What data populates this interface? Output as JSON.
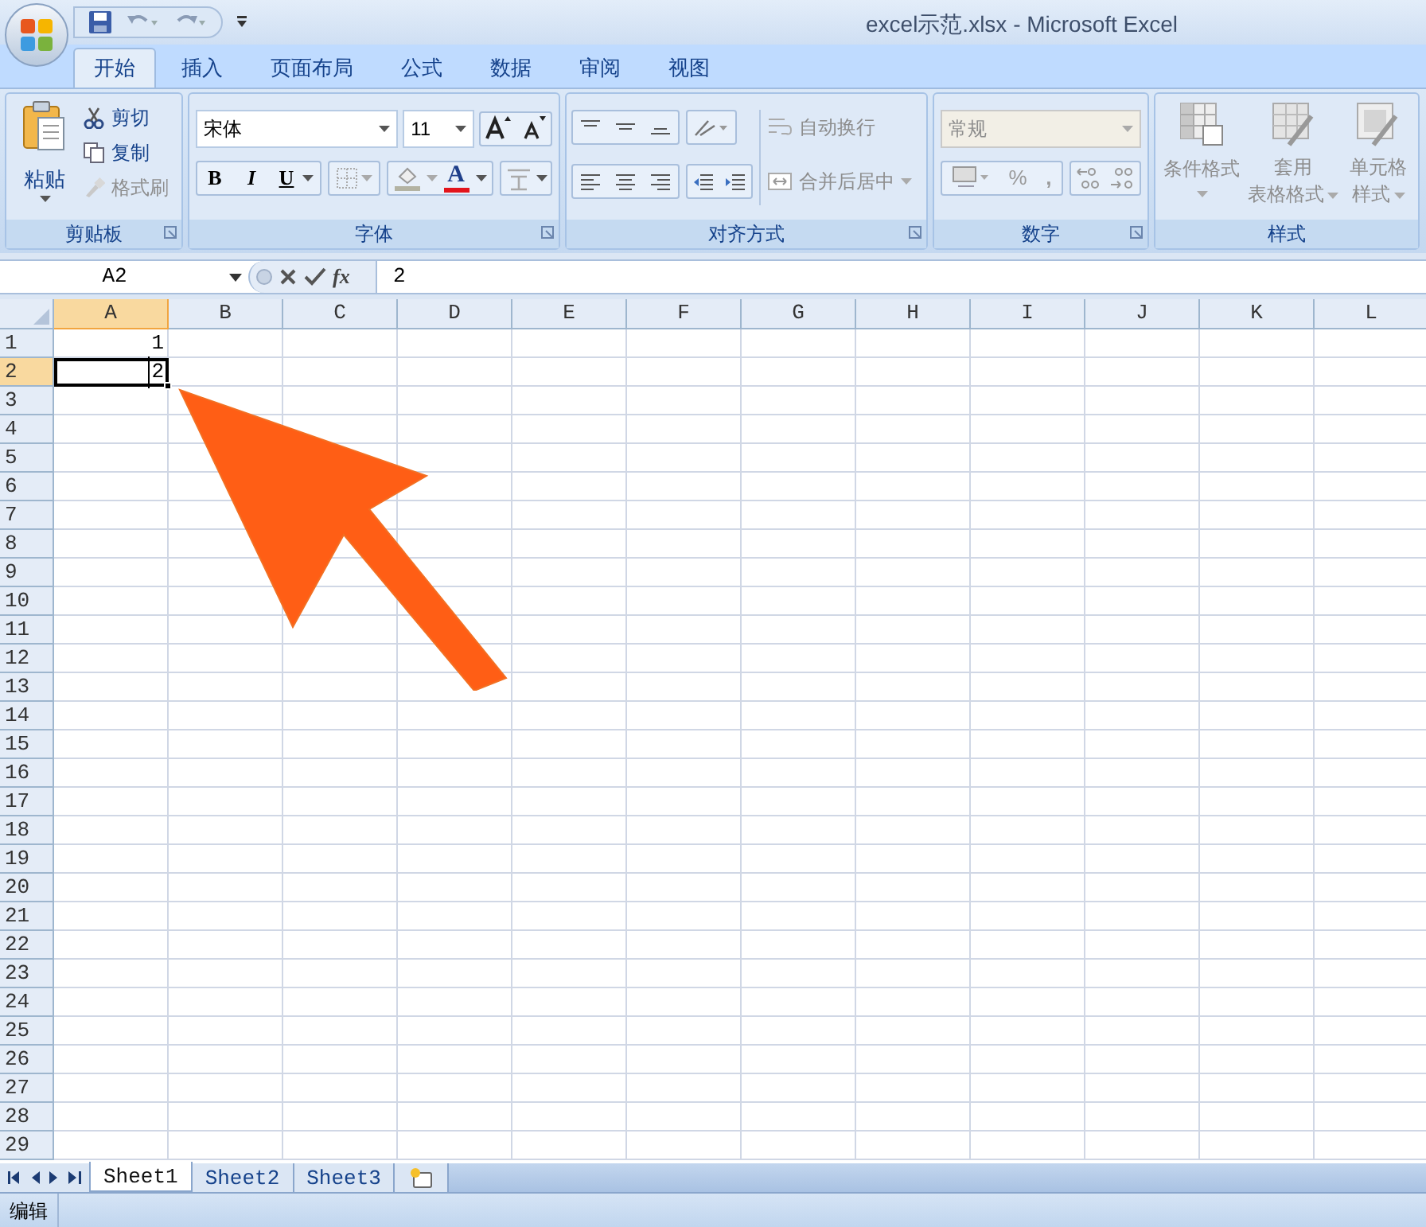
{
  "window": {
    "title": "excel示范.xlsx - Microsoft Excel"
  },
  "tabs": [
    {
      "label": "开始",
      "selected": true
    },
    {
      "label": "插入",
      "selected": false
    },
    {
      "label": "页面布局",
      "selected": false
    },
    {
      "label": "公式",
      "selected": false
    },
    {
      "label": "数据",
      "selected": false
    },
    {
      "label": "审阅",
      "selected": false
    },
    {
      "label": "视图",
      "selected": false
    }
  ],
  "ribbon": {
    "clipboard": {
      "label": "剪贴板",
      "paste": "粘贴",
      "cut": "剪切",
      "copy": "复制",
      "format_painter": {
        "label": "格式刷",
        "disabled": true
      }
    },
    "font": {
      "label": "字体",
      "font_name": "宋体",
      "font_size": "11",
      "bold": "B",
      "italic": "I",
      "underline": "U",
      "font_color": "A"
    },
    "alignment": {
      "label": "对齐方式",
      "wrap_text": {
        "label": "自动换行",
        "disabled": true
      },
      "merge_center": {
        "label": "合并后居中",
        "disabled": true
      }
    },
    "number": {
      "label": "数字",
      "format": {
        "value": "常规",
        "disabled": true
      },
      "percent": "%",
      "comma": ","
    },
    "styles": {
      "label": "样式",
      "conditional_formatting": {
        "label": "条件格式",
        "disabled": true
      },
      "format_as_table": {
        "lines": [
          "套用",
          "表格格式"
        ],
        "disabled": true
      },
      "cell_styles": {
        "lines": [
          "单元格",
          "样式"
        ],
        "disabled": true
      }
    }
  },
  "formula_bar": {
    "name_box": "A2",
    "insert_function": "fx",
    "formula": "2"
  },
  "columns": [
    {
      "label": "A",
      "selected": true
    },
    {
      "label": "B",
      "selected": false
    },
    {
      "label": "C",
      "selected": false
    },
    {
      "label": "D",
      "selected": false
    },
    {
      "label": "E",
      "selected": false
    },
    {
      "label": "F",
      "selected": false
    },
    {
      "label": "G",
      "selected": false
    },
    {
      "label": "H",
      "selected": false
    },
    {
      "label": "I",
      "selected": false
    },
    {
      "label": "J",
      "selected": false
    },
    {
      "label": "K",
      "selected": false
    },
    {
      "label": "L",
      "selected": false
    }
  ],
  "rows": [
    {
      "label": "1",
      "selected": false,
      "cells": [
        {
          "value": "1",
          "selected": false
        }
      ]
    },
    {
      "label": "2",
      "selected": true,
      "cells": [
        {
          "value": "2",
          "selected": true
        }
      ]
    },
    {
      "label": "3",
      "selected": false
    },
    {
      "label": "4",
      "selected": false
    },
    {
      "label": "5",
      "selected": false
    },
    {
      "label": "6",
      "selected": false
    },
    {
      "label": "7",
      "selected": false
    },
    {
      "label": "8",
      "selected": false
    },
    {
      "label": "9",
      "selected": false
    },
    {
      "label": "10",
      "selected": false
    },
    {
      "label": "11",
      "selected": false
    },
    {
      "label": "12",
      "selected": false
    },
    {
      "label": "13",
      "selected": false
    },
    {
      "label": "14",
      "selected": false
    },
    {
      "label": "15",
      "selected": false
    },
    {
      "label": "16",
      "selected": false
    },
    {
      "label": "17",
      "selected": false
    },
    {
      "label": "18",
      "selected": false
    },
    {
      "label": "19",
      "selected": false
    },
    {
      "label": "20",
      "selected": false
    },
    {
      "label": "21",
      "selected": false
    },
    {
      "label": "22",
      "selected": false
    },
    {
      "label": "23",
      "selected": false
    },
    {
      "label": "24",
      "selected": false
    },
    {
      "label": "25",
      "selected": false
    },
    {
      "label": "26",
      "selected": false
    },
    {
      "label": "27",
      "selected": false
    },
    {
      "label": "28",
      "selected": false
    },
    {
      "label": "29",
      "selected": false
    }
  ],
  "sheet_tabs": [
    {
      "label": "Sheet1",
      "selected": true
    },
    {
      "label": "Sheet2",
      "selected": false
    },
    {
      "label": "Sheet3",
      "selected": false
    }
  ],
  "status_bar": {
    "mode": "编辑"
  }
}
